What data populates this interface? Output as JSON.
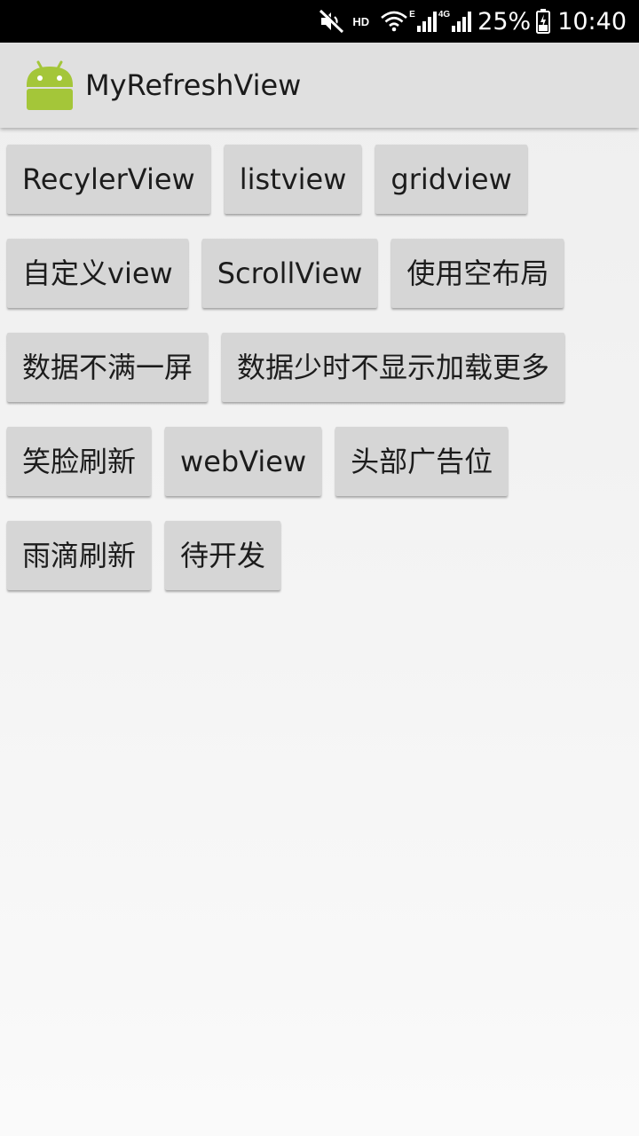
{
  "status_bar": {
    "hd_label": "HD",
    "network_type_1": "E",
    "network_type_2": "4G",
    "battery_percent": "25%",
    "time": "10:40",
    "icons": [
      "mute-icon",
      "wifi-icon",
      "signal-icon",
      "battery-icon"
    ]
  },
  "app_bar": {
    "title": "MyRefreshView",
    "logo_icon": "android-logo-icon",
    "logo_color": "#a4c639"
  },
  "buttons": {
    "rows": [
      [
        "RecylerView",
        "listview",
        "gridview"
      ],
      [
        "自定义view",
        "ScrollView",
        "使用空布局"
      ],
      [
        "数据不满一屏",
        "数据少时不显示加载更多"
      ],
      [
        "笑脸刷新",
        "webView",
        "头部广告位"
      ],
      [
        "雨滴刷新",
        "待开发"
      ]
    ]
  },
  "colors": {
    "status_bar_bg": "#000000",
    "app_bar_bg": "#e0e0e0",
    "button_bg": "#d6d6d6",
    "page_bg": "#f2f2f2"
  }
}
